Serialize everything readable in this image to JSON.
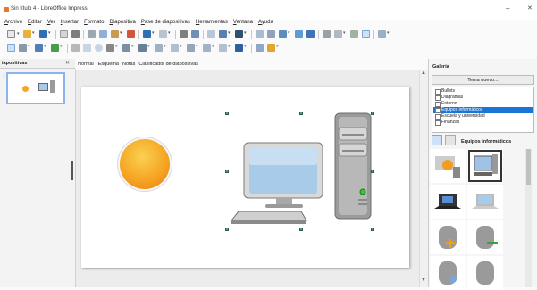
{
  "window": {
    "title": "Sin título 4 - LibreOffice Impress",
    "minimize": "–",
    "close": "✕"
  },
  "menu": [
    {
      "mnemonic": "A",
      "rest": "rchivo"
    },
    {
      "mnemonic": "E",
      "rest": "ditar"
    },
    {
      "mnemonic": "V",
      "rest": "er"
    },
    {
      "mnemonic": "I",
      "rest": "nsertar"
    },
    {
      "mnemonic": "F",
      "rest": "ormato"
    },
    {
      "mnemonic": "D",
      "rest": "iapositiva"
    },
    {
      "mnemonic": "P",
      "rest": "ase de diapositivas"
    },
    {
      "mnemonic": "H",
      "rest": "erramientas"
    },
    {
      "mnemonic": "V",
      "rest": "entana"
    },
    {
      "mnemonic": "A",
      "rest": "yuda"
    }
  ],
  "slides_pane": {
    "title": "iapositivas",
    "close": "✕",
    "thumb_number": "1"
  },
  "view_tabs": [
    "Normal",
    "Esquema",
    "Notas",
    "Clasificador de diapositivas"
  ],
  "gallery": {
    "title": "Galería",
    "new_theme_button": "Tema nuevo...",
    "themes": [
      "Bullets",
      "Diagramas",
      "Entorno",
      "Equipos informáticos",
      "Escuela y universidad",
      "Finanzas"
    ],
    "selected_theme": "Equipos informáticos",
    "current_label": "Equipos informáticos"
  },
  "colors": {
    "accent": "#1c74d4",
    "selection_handle": "#5a9a7a",
    "sun": "#f5a623"
  },
  "icons": [
    "new-doc-icon",
    "open-folder-icon",
    "save-icon",
    "export-pdf-icon",
    "print-icon",
    "cut-icon",
    "copy-icon",
    "paste-icon",
    "clone-formatting-icon",
    "undo-icon",
    "redo-icon",
    "find-replace-icon",
    "spelling-icon",
    "grid-icon",
    "display-views-icon",
    "master-slide-icon",
    "table-icon",
    "image-icon",
    "media-icon",
    "chart-icon",
    "textbox-icon",
    "special-char-icon",
    "fontwork-icon",
    "gallery-icon",
    "start-slideshow-icon",
    "new-slide-icon",
    "select-icon",
    "zoom-icon",
    "line-color-icon",
    "fill-color-icon",
    "line-icon",
    "rectangle-icon",
    "ellipse-icon",
    "arrow-icon",
    "curve-icon",
    "connector-icon",
    "basic-shapes-icon",
    "symbol-shapes-icon",
    "block-arrows-icon",
    "flowchart-icon",
    "callouts-icon",
    "stars-icon",
    "shadow-icon",
    "3d-icon"
  ]
}
